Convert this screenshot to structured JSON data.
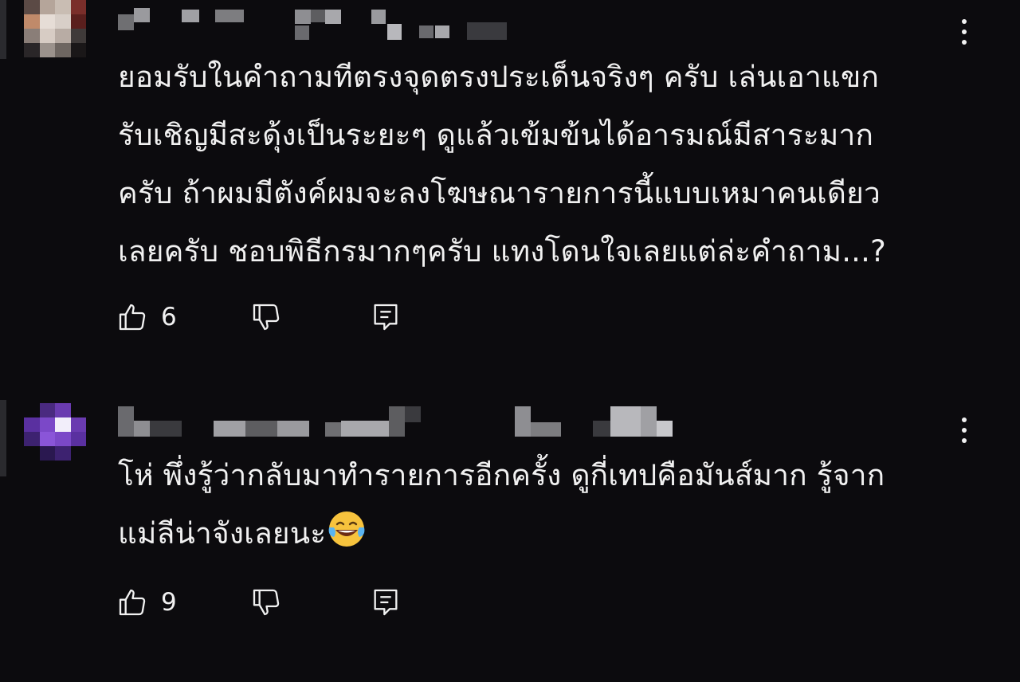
{
  "comments": [
    {
      "text_lines": [
        "ยอมรับในคำถามทีตรงจุดตรงประเด็นจริงๆ ครับ เล่นเอาแขก",
        "รับเชิญมีสะดุ้งเป็นระยะๆ ดูแล้วเข้มข้นได้อารมณ์มีสาระมาก",
        "ครับ ถ้าผมมีตังค์ผมจะลงโฆษณารายการนี้แบบเหมาคนเดียว",
        "เลยครับ ชอบพิธีกรมากๆครับ แทงโดนใจเลยแต่ล่ะคำถาม...?"
      ],
      "like_count": "6",
      "avatar_colors": [
        "#5b4a45",
        "#b5a59a",
        "#c9bdb3",
        "#7a2e2a",
        "#c08a6a",
        "#e6ddd6",
        "#d8cfc8",
        "#5a1f1d",
        "#8a7e78",
        "#d7ccc4",
        "#b8aca4",
        "#3f3a39",
        "#2a2628",
        "#9b928c",
        "#6e6661",
        "#1a1718"
      ],
      "avatar_shape": "pixelated",
      "username_redacted": true
    },
    {
      "text_lines": [
        "โห่ พึ่งรู้ว่ากลับมาทำรายการอีกครั้ง ดูกี่เทปคือมันส์มาก รู้จาก",
        "แม่ลีน่าจังเลยนะ"
      ],
      "emoji": "face-with-tears-of-joy",
      "like_count": "9",
      "avatar_colors": [
        "#0c0b0e",
        "#4a2a80",
        "#6a3bb0",
        "#0c0b0e",
        "#5a30a0",
        "#7b48c8",
        "#f2eefa",
        "#6a3bb0",
        "#3d2270",
        "#8a55d8",
        "#7b48c8",
        "#5a30a0",
        "#0c0b0e",
        "#2a1850",
        "#3d2270",
        "#0c0b0e"
      ],
      "avatar_shape": "pixelated",
      "username_redacted": true
    }
  ],
  "colors": {
    "background": "#0c0b0e",
    "text": "#f1f1f1",
    "redaction": "#8a8a8e"
  },
  "icons": {
    "like": "thumbs-up-icon",
    "dislike": "thumbs-down-icon",
    "reply": "reply-comment-icon",
    "menu": "more-vertical-icon"
  }
}
